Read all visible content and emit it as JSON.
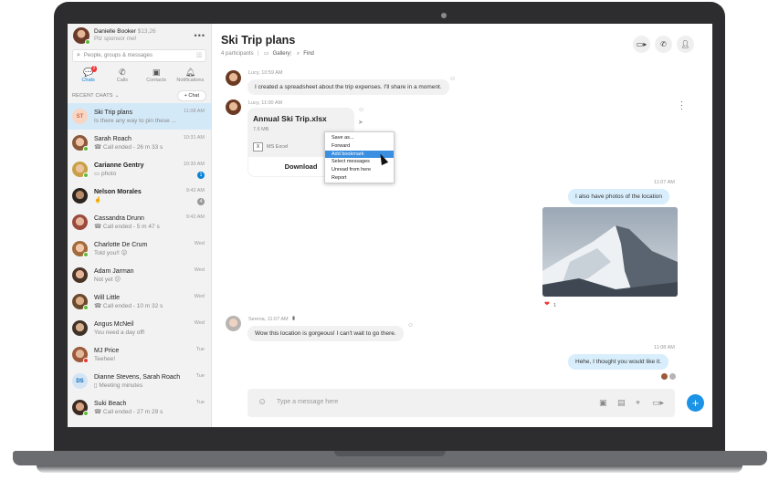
{
  "profile": {
    "name": "Danielle Booker",
    "balance": "$13,26",
    "status": "Plz sponsor me!"
  },
  "search": {
    "placeholder": "People, groups & messages"
  },
  "nav": {
    "tabs": [
      {
        "label": "Chats",
        "badge": "2"
      },
      {
        "label": "Calls"
      },
      {
        "label": "Contacts"
      },
      {
        "label": "Notifications"
      }
    ]
  },
  "recent": {
    "label": "RECENT CHATS",
    "new_chat": "+ Chat"
  },
  "chats": [
    {
      "name": "Ski Trip plans",
      "preview": "Is there any way to pin these ...",
      "time": "11:08 AM",
      "initials": "ST"
    },
    {
      "name": "Sarah Roach",
      "preview": "Call ended - 26 m 33 s",
      "time": "10:31 AM"
    },
    {
      "name": "Carianne Gentry",
      "preview": "photo",
      "time": "10:30 AM",
      "unread": "1"
    },
    {
      "name": "Nelson Morales",
      "preview": "🤞",
      "time": "9:42 AM",
      "unread": "4"
    },
    {
      "name": "Cassandra Drunn",
      "preview": "Call ended - 5 m 47 s",
      "time": "9:42 AM"
    },
    {
      "name": "Charlotte De Crum",
      "preview": "Told you!! 😛",
      "time": "Wed"
    },
    {
      "name": "Adam Jarman",
      "preview": "Not yet 😕",
      "time": "Wed"
    },
    {
      "name": "Will Little",
      "preview": "Call ended - 10 m 32 s",
      "time": "Wed"
    },
    {
      "name": "Angus McNeil",
      "preview": "You need a day off!",
      "time": "Wed"
    },
    {
      "name": "MJ Price",
      "preview": "Teehee!",
      "time": "Tue"
    },
    {
      "name": "Dianne Stevens, Sarah Roach",
      "preview": "Meeting minutes",
      "time": "Tue",
      "initials": "DS"
    },
    {
      "name": "Suki Beach",
      "preview": "Call ended - 27 m 29 s",
      "time": "Tue"
    }
  ],
  "conversation": {
    "title": "Ski Trip plans",
    "participants": "4 participants",
    "gallery": "Gallery",
    "find": "Find",
    "messages": {
      "m1_meta": "Lucy, 10:59 AM",
      "m1_text": "I created a spreadsheet about the trip expenses. I'll share in a moment.",
      "m2_meta": "Lucy, 11:00 AM",
      "file_name": "Annual Ski Trip.xlsx",
      "file_size": "7.6 MB",
      "file_app": "MS Excel",
      "file_download": "Download",
      "m3_time": "11:07 AM",
      "m3_text": "I also have photos of the location",
      "photo_reactions": "1",
      "m4_meta": "Serena, 11:07 AM",
      "m4_text": "Wow this location is gorgeous! I can't wait to go there.",
      "m5_time": "11:08 AM",
      "m5_text": "Hehe, I thought you would like it."
    },
    "context_menu": [
      "Save as...",
      "Forward",
      "Add bookmark",
      "Select messages",
      "Unread from here",
      "Report"
    ],
    "context_highlight": "Add bookmark",
    "composer_placeholder": "Type a message here"
  },
  "colors": {
    "accent": "#1b93e6",
    "selected_chat": "#d4e9f8",
    "my_bubble": "#d9eefc"
  }
}
